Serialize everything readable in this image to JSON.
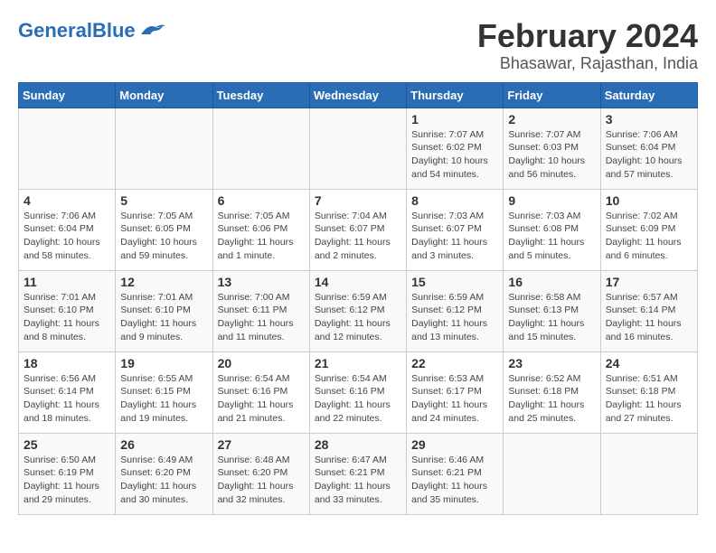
{
  "logo": {
    "text_general": "General",
    "text_blue": "Blue"
  },
  "title": "February 2024",
  "location": "Bhasawar, Rajasthan, India",
  "weekdays": [
    "Sunday",
    "Monday",
    "Tuesday",
    "Wednesday",
    "Thursday",
    "Friday",
    "Saturday"
  ],
  "weeks": [
    [
      {
        "day": "",
        "info": ""
      },
      {
        "day": "",
        "info": ""
      },
      {
        "day": "",
        "info": ""
      },
      {
        "day": "",
        "info": ""
      },
      {
        "day": "1",
        "info": "Sunrise: 7:07 AM\nSunset: 6:02 PM\nDaylight: 10 hours\nand 54 minutes."
      },
      {
        "day": "2",
        "info": "Sunrise: 7:07 AM\nSunset: 6:03 PM\nDaylight: 10 hours\nand 56 minutes."
      },
      {
        "day": "3",
        "info": "Sunrise: 7:06 AM\nSunset: 6:04 PM\nDaylight: 10 hours\nand 57 minutes."
      }
    ],
    [
      {
        "day": "4",
        "info": "Sunrise: 7:06 AM\nSunset: 6:04 PM\nDaylight: 10 hours\nand 58 minutes."
      },
      {
        "day": "5",
        "info": "Sunrise: 7:05 AM\nSunset: 6:05 PM\nDaylight: 10 hours\nand 59 minutes."
      },
      {
        "day": "6",
        "info": "Sunrise: 7:05 AM\nSunset: 6:06 PM\nDaylight: 11 hours\nand 1 minute."
      },
      {
        "day": "7",
        "info": "Sunrise: 7:04 AM\nSunset: 6:07 PM\nDaylight: 11 hours\nand 2 minutes."
      },
      {
        "day": "8",
        "info": "Sunrise: 7:03 AM\nSunset: 6:07 PM\nDaylight: 11 hours\nand 3 minutes."
      },
      {
        "day": "9",
        "info": "Sunrise: 7:03 AM\nSunset: 6:08 PM\nDaylight: 11 hours\nand 5 minutes."
      },
      {
        "day": "10",
        "info": "Sunrise: 7:02 AM\nSunset: 6:09 PM\nDaylight: 11 hours\nand 6 minutes."
      }
    ],
    [
      {
        "day": "11",
        "info": "Sunrise: 7:01 AM\nSunset: 6:10 PM\nDaylight: 11 hours\nand 8 minutes."
      },
      {
        "day": "12",
        "info": "Sunrise: 7:01 AM\nSunset: 6:10 PM\nDaylight: 11 hours\nand 9 minutes."
      },
      {
        "day": "13",
        "info": "Sunrise: 7:00 AM\nSunset: 6:11 PM\nDaylight: 11 hours\nand 11 minutes."
      },
      {
        "day": "14",
        "info": "Sunrise: 6:59 AM\nSunset: 6:12 PM\nDaylight: 11 hours\nand 12 minutes."
      },
      {
        "day": "15",
        "info": "Sunrise: 6:59 AM\nSunset: 6:12 PM\nDaylight: 11 hours\nand 13 minutes."
      },
      {
        "day": "16",
        "info": "Sunrise: 6:58 AM\nSunset: 6:13 PM\nDaylight: 11 hours\nand 15 minutes."
      },
      {
        "day": "17",
        "info": "Sunrise: 6:57 AM\nSunset: 6:14 PM\nDaylight: 11 hours\nand 16 minutes."
      }
    ],
    [
      {
        "day": "18",
        "info": "Sunrise: 6:56 AM\nSunset: 6:14 PM\nDaylight: 11 hours\nand 18 minutes."
      },
      {
        "day": "19",
        "info": "Sunrise: 6:55 AM\nSunset: 6:15 PM\nDaylight: 11 hours\nand 19 minutes."
      },
      {
        "day": "20",
        "info": "Sunrise: 6:54 AM\nSunset: 6:16 PM\nDaylight: 11 hours\nand 21 minutes."
      },
      {
        "day": "21",
        "info": "Sunrise: 6:54 AM\nSunset: 6:16 PM\nDaylight: 11 hours\nand 22 minutes."
      },
      {
        "day": "22",
        "info": "Sunrise: 6:53 AM\nSunset: 6:17 PM\nDaylight: 11 hours\nand 24 minutes."
      },
      {
        "day": "23",
        "info": "Sunrise: 6:52 AM\nSunset: 6:18 PM\nDaylight: 11 hours\nand 25 minutes."
      },
      {
        "day": "24",
        "info": "Sunrise: 6:51 AM\nSunset: 6:18 PM\nDaylight: 11 hours\nand 27 minutes."
      }
    ],
    [
      {
        "day": "25",
        "info": "Sunrise: 6:50 AM\nSunset: 6:19 PM\nDaylight: 11 hours\nand 29 minutes."
      },
      {
        "day": "26",
        "info": "Sunrise: 6:49 AM\nSunset: 6:20 PM\nDaylight: 11 hours\nand 30 minutes."
      },
      {
        "day": "27",
        "info": "Sunrise: 6:48 AM\nSunset: 6:20 PM\nDaylight: 11 hours\nand 32 minutes."
      },
      {
        "day": "28",
        "info": "Sunrise: 6:47 AM\nSunset: 6:21 PM\nDaylight: 11 hours\nand 33 minutes."
      },
      {
        "day": "29",
        "info": "Sunrise: 6:46 AM\nSunset: 6:21 PM\nDaylight: 11 hours\nand 35 minutes."
      },
      {
        "day": "",
        "info": ""
      },
      {
        "day": "",
        "info": ""
      }
    ]
  ]
}
